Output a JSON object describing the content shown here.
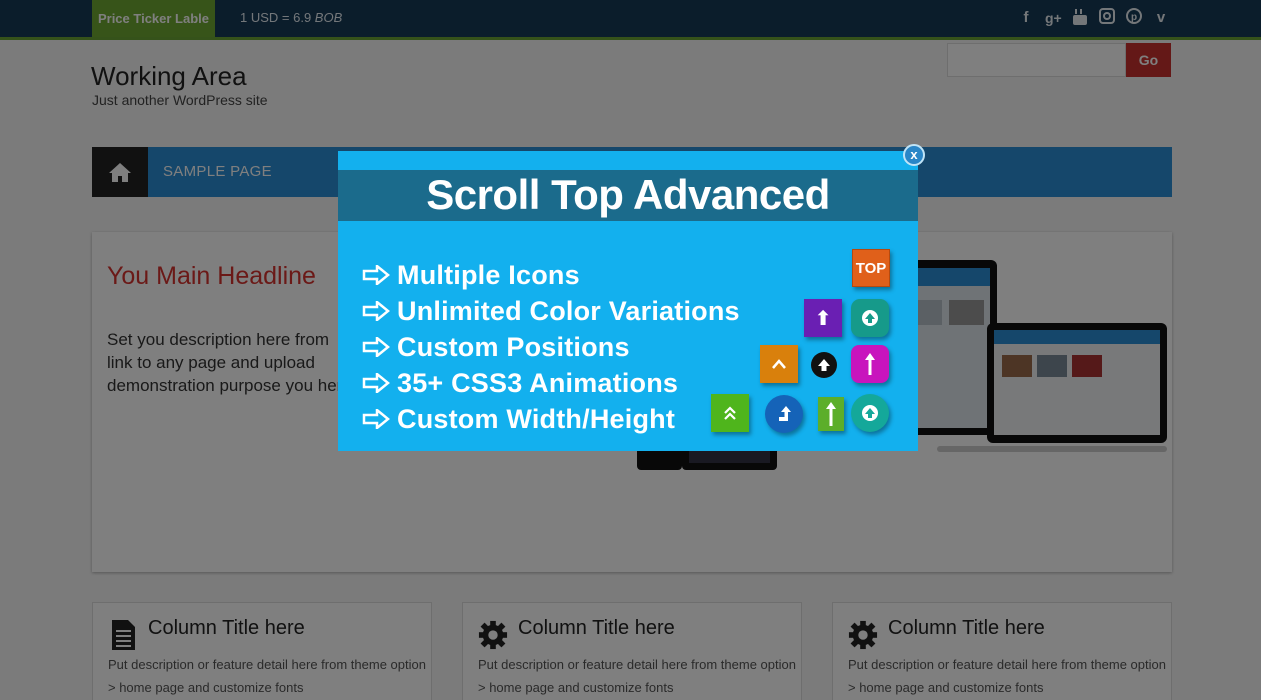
{
  "topbar": {
    "ticker_label": "Price Ticker Lable",
    "ticker_text": "1 USD = 6.9 ",
    "ticker_unit": "BOB",
    "social_icons": [
      "facebook-icon",
      "google-plus-icon",
      "youtube-icon",
      "instagram-icon",
      "pinterest-icon",
      "vimeo-icon"
    ]
  },
  "header": {
    "site_title": "Working Area",
    "site_description": "Just another WordPress site",
    "search_placeholder": "",
    "go_label": "Go"
  },
  "nav": {
    "home_icon": "home-icon",
    "items": [
      {
        "label": "SAMPLE PAGE"
      }
    ]
  },
  "hero": {
    "headline": "You Main Headline",
    "description": "Set you description here from link to any page and upload demonstration purpose you here."
  },
  "columns": [
    {
      "icon": "document-icon",
      "title": "Column Title here",
      "description": "Put description or feature detail here from theme option > home page and customize fonts"
    },
    {
      "icon": "gear-icon",
      "title": "Column Title here",
      "description": "Put description or feature detail here from theme option > home page and customize fonts"
    },
    {
      "icon": "gear-icon",
      "title": "Column Title here",
      "description": "Put description or feature detail here from theme option > home page and customize fonts"
    }
  ],
  "popup": {
    "title": "Scroll Top Advanced",
    "close_label": "x",
    "features": [
      "Multiple Icons",
      "Unlimited Color Variations",
      "Custom Positions",
      "35+ CSS3 Animations",
      "Custom Width/Height"
    ],
    "top_badge": "TOP"
  },
  "colors": {
    "topbar_bg": "#173a57",
    "accent_green": "#6fa833",
    "go_red": "#c8302e",
    "nav_blue": "#2b8fd6",
    "headline_red": "#d6332f",
    "popup_blue": "#13b0ee",
    "popup_band": "#1b6b8c"
  }
}
